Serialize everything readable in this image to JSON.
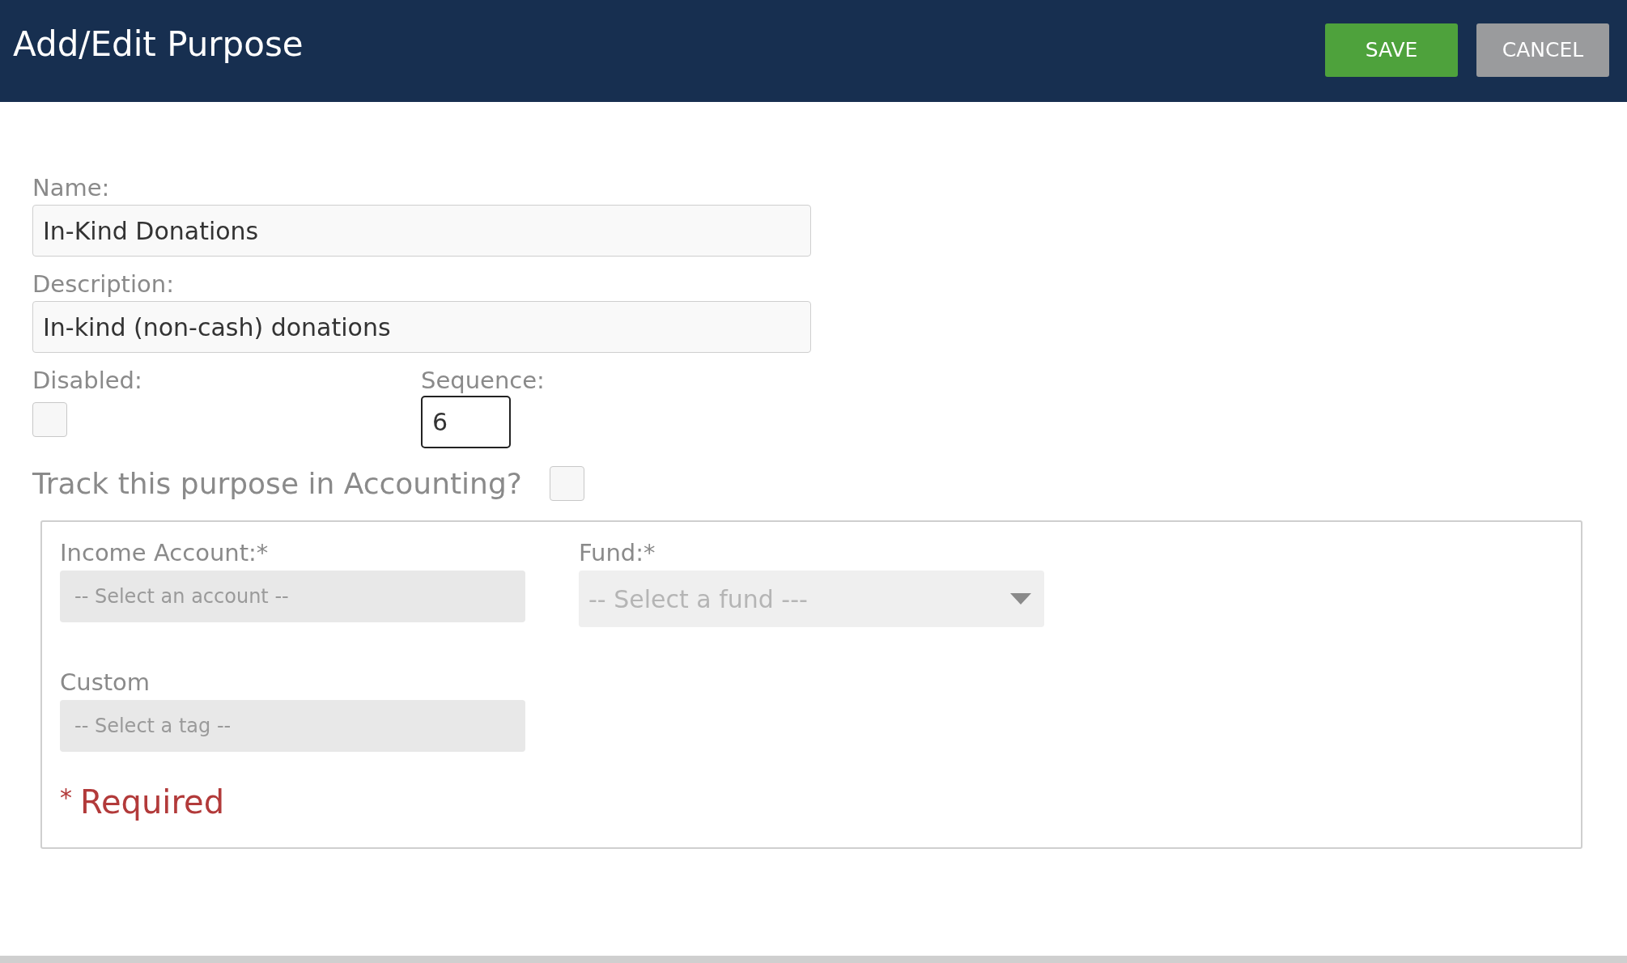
{
  "header": {
    "title": "Add/Edit Purpose",
    "buttons": [
      {
        "label": "SAVE",
        "kind": "primary"
      },
      {
        "label": "CANCEL",
        "kind": "secondary"
      }
    ]
  },
  "form": {
    "name": {
      "label": "Name:",
      "value": "In-Kind Donations"
    },
    "description": {
      "label": "Description:",
      "value": "In-kind (non-cash) donations"
    },
    "disabled": {
      "label": "Disabled:",
      "checked": false
    },
    "sequence": {
      "label": "Sequence:",
      "value": "6"
    },
    "track": {
      "label": "Track this purpose in Accounting?",
      "checked": false
    }
  },
  "accounting": {
    "income_account": {
      "label": "Income Account:*",
      "placeholder": "-- Select an account --"
    },
    "fund": {
      "label": "Fund:*",
      "placeholder": "-- Select a fund ---"
    },
    "custom": {
      "label": "Custom",
      "placeholder": "-- Select a tag --"
    },
    "required_note": {
      "mark": "*",
      "text": "Required"
    }
  }
}
